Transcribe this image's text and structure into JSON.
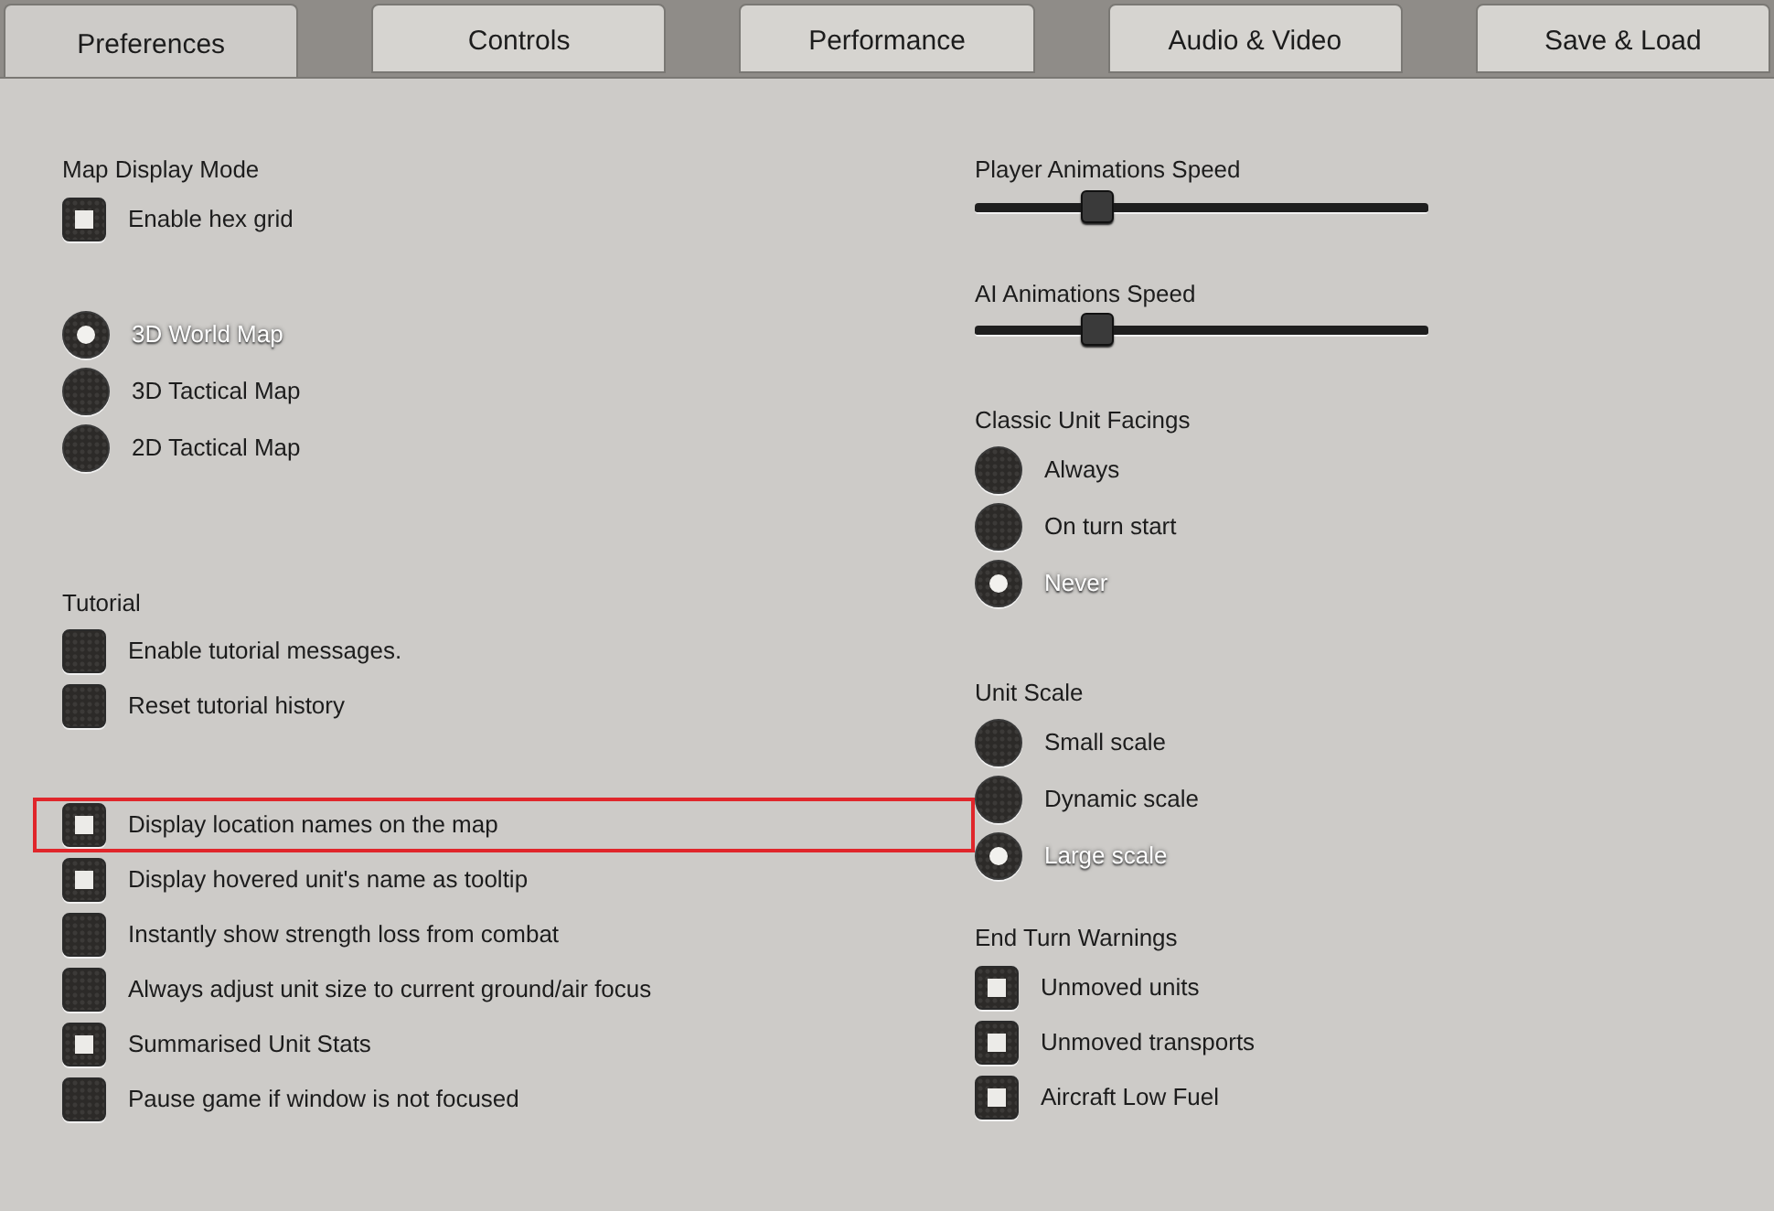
{
  "tabs": [
    {
      "label": "Preferences",
      "selected": true
    },
    {
      "label": "Controls",
      "selected": false
    },
    {
      "label": "Performance",
      "selected": false
    },
    {
      "label": "Audio & Video",
      "selected": false
    },
    {
      "label": "Save & Load",
      "selected": false
    }
  ],
  "columns": [
    {
      "groups": [
        {
          "title": "Map Display Mode",
          "items": [
            {
              "kind": "checkbox",
              "label": "Enable hex grid",
              "checked": true,
              "highlighted": false
            }
          ]
        },
        {
          "items": [
            {
              "kind": "radio",
              "label": "3D World Map",
              "selected": true
            },
            {
              "kind": "radio",
              "label": "3D Tactical Map",
              "selected": false
            },
            {
              "kind": "radio",
              "label": "2D Tactical Map",
              "selected": false
            }
          ]
        },
        {
          "title": "Tutorial",
          "items": [
            {
              "kind": "checkbox",
              "label": "Enable tutorial messages.",
              "checked": false,
              "highlighted": false
            },
            {
              "kind": "checkbox",
              "label": "Reset tutorial history",
              "checked": false,
              "highlighted": false
            }
          ]
        },
        {
          "items": [
            {
              "kind": "checkbox",
              "label": "Display location names on the map",
              "checked": true,
              "highlighted": true
            },
            {
              "kind": "checkbox",
              "label": "Display hovered unit's name as tooltip",
              "checked": true,
              "highlighted": false
            },
            {
              "kind": "checkbox",
              "label": "Instantly show strength loss from combat",
              "checked": false,
              "highlighted": false
            },
            {
              "kind": "checkbox",
              "label": "Always adjust unit size to current ground/air focus",
              "checked": false,
              "highlighted": false
            },
            {
              "kind": "checkbox",
              "label": "Summarised Unit Stats",
              "checked": true,
              "highlighted": false
            },
            {
              "kind": "checkbox",
              "label": "Pause game if window is not focused",
              "checked": false,
              "highlighted": false
            }
          ]
        }
      ]
    },
    {
      "groups": [
        {
          "title": "Player Animations Speed",
          "items": [
            {
              "kind": "slider",
              "level": 0.27
            }
          ]
        },
        {
          "title": "AI Animations Speed",
          "items": [
            {
              "kind": "slider",
              "level": 0.27
            }
          ]
        },
        {
          "title": "Classic Unit Facings",
          "items": [
            {
              "kind": "radio",
              "label": "Always",
              "selected": false
            },
            {
              "kind": "radio",
              "label": "On turn start",
              "selected": false
            },
            {
              "kind": "radio",
              "label": "Never",
              "selected": true
            }
          ]
        },
        {
          "title": "Unit Scale",
          "items": [
            {
              "kind": "radio",
              "label": "Small scale",
              "selected": false
            },
            {
              "kind": "radio",
              "label": "Dynamic scale",
              "selected": false
            },
            {
              "kind": "radio",
              "label": "Large scale",
              "selected": true
            }
          ]
        },
        {
          "title": "End Turn Warnings",
          "items": [
            {
              "kind": "checkbox",
              "label": "Unmoved units",
              "checked": true,
              "highlighted": false
            },
            {
              "kind": "checkbox",
              "label": "Unmoved transports",
              "checked": true,
              "highlighted": false
            },
            {
              "kind": "checkbox",
              "label": "Aircraft Low Fuel",
              "checked": true,
              "highlighted": false
            }
          ]
        }
      ]
    }
  ]
}
